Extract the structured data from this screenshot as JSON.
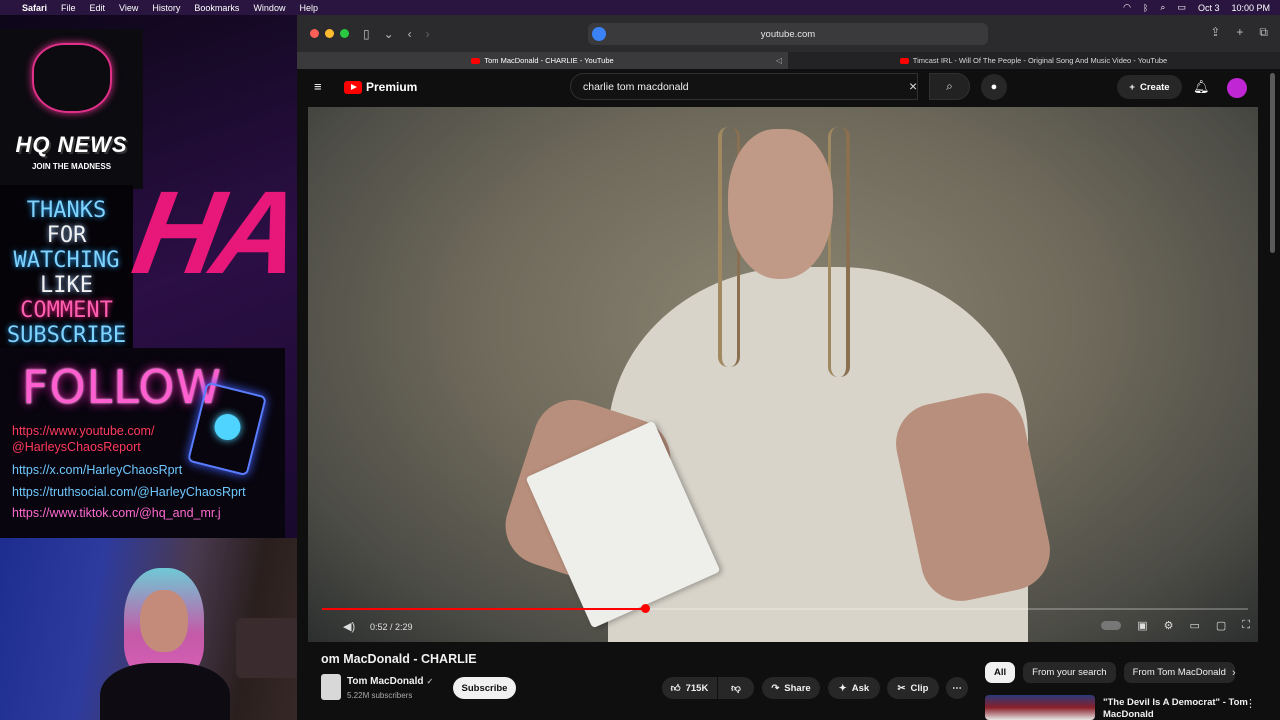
{
  "menubar": {
    "app": "Safari",
    "items": [
      "File",
      "Edit",
      "View",
      "History",
      "Bookmarks",
      "Window",
      "Help"
    ],
    "date": "Oct 3",
    "time": "10:00 PM"
  },
  "overlay": {
    "logo_title": "HQ NEWS",
    "logo_sub": "JOIN THE MADNESS",
    "thanks_lines": [
      "THANKS",
      "FOR",
      "WATCHING",
      "LIKE",
      "COMMENT",
      "SUBSCRIBE"
    ],
    "ha_text": "HA",
    "follow_title": "FOLLOW",
    "links": {
      "youtube_1": "https://www.youtube.com/",
      "youtube_2": "@HarleysChaosReport",
      "x": "https://x.com/HarleyChaosRprt",
      "truthsocial": "https://truthsocial.com/@HarleyChaosRprt",
      "tiktok": "https://www.tiktok.com/@hq_and_mr.j"
    }
  },
  "browser": {
    "address": "youtube.com",
    "tabs": [
      {
        "title": "Tom MacDonald - CHARLIE - YouTube"
      },
      {
        "title": "Timcast IRL - Will Of The People - Original Song And Music Video - YouTube"
      }
    ]
  },
  "youtube": {
    "logo": "Premium",
    "search_value": "charlie tom macdonald",
    "create_label": "Create",
    "player": {
      "time": "0:52 / 2:29",
      "progress_fraction": 0.349
    },
    "video_title": "om MacDonald - CHARLIE",
    "channel": {
      "name": "Tom MacDonald",
      "subscribers": "5.22M subscribers",
      "subscribe_label": "Subscribe"
    },
    "actions": {
      "likes": "715K",
      "share": "Share",
      "ask": "Ask",
      "clip": "Clip"
    },
    "chips": [
      "All",
      "From your search",
      "From Tom MacDonald"
    ],
    "recommendation": {
      "title": "\"The Devil Is A Democrat\" - Tom MacDonald"
    }
  },
  "colors": {
    "youtube_red": "#ff0000",
    "overlay_pink": "#e8177a",
    "subscribe_bg": "#f1f1f1"
  }
}
